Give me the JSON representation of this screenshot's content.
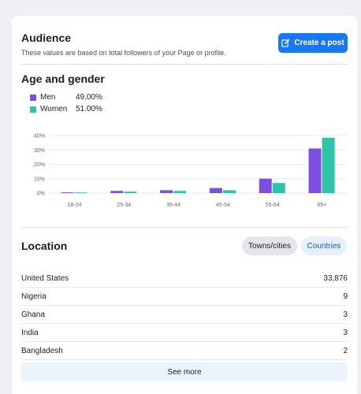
{
  "header": {
    "title": "Audience",
    "subtitle": "These values are based on total followers of your Page or profile.",
    "create_post_label": "Create a post",
    "create_post_icon": "edit-icon"
  },
  "age_gender": {
    "title": "Age and gender",
    "legend": [
      {
        "name": "Men",
        "value": "49.00%",
        "color": "#7d4fe0"
      },
      {
        "name": "Women",
        "value": "51.00%",
        "color": "#2ec4a8"
      }
    ]
  },
  "chart_data": {
    "type": "bar",
    "title": "",
    "xlabel": "",
    "ylabel": "",
    "categories": [
      "18-24",
      "25-34",
      "35-44",
      "45-54",
      "55-64",
      "65+"
    ],
    "series": [
      {
        "name": "Men",
        "values": [
          0.5,
          1.5,
          2.0,
          3.5,
          10.0,
          31.0
        ],
        "color": "#7d4fe0"
      },
      {
        "name": "Women",
        "values": [
          0.4,
          1.0,
          1.5,
          2.0,
          7.0,
          38.5
        ],
        "color": "#2ec4a8"
      }
    ],
    "y_ticks": [
      "0%",
      "10%",
      "20%",
      "30%",
      "40%"
    ],
    "ylim": [
      0,
      40
    ],
    "grid": true
  },
  "location": {
    "title": "Location",
    "tabs": [
      {
        "label": "Towns/cities",
        "selected": false
      },
      {
        "label": "Countries",
        "selected": true
      }
    ],
    "rows": [
      {
        "name": "United States",
        "value": "33,876"
      },
      {
        "name": "Nigeria",
        "value": "9"
      },
      {
        "name": "Ghana",
        "value": "3"
      },
      {
        "name": "India",
        "value": "3"
      },
      {
        "name": "Bangladesh",
        "value": "2"
      }
    ],
    "see_more_label": "See more"
  }
}
